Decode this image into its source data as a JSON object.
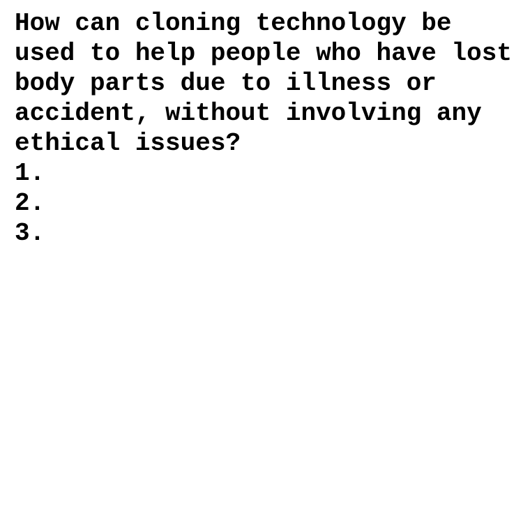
{
  "document": {
    "question": "How can cloning technology be used to help people who have lost body parts due to illness or accident, without involving any ethical issues?",
    "list_items": [
      "1.",
      "2.",
      "3."
    ]
  },
  "colors": {
    "text": "#000000",
    "background": "#ffffff"
  }
}
